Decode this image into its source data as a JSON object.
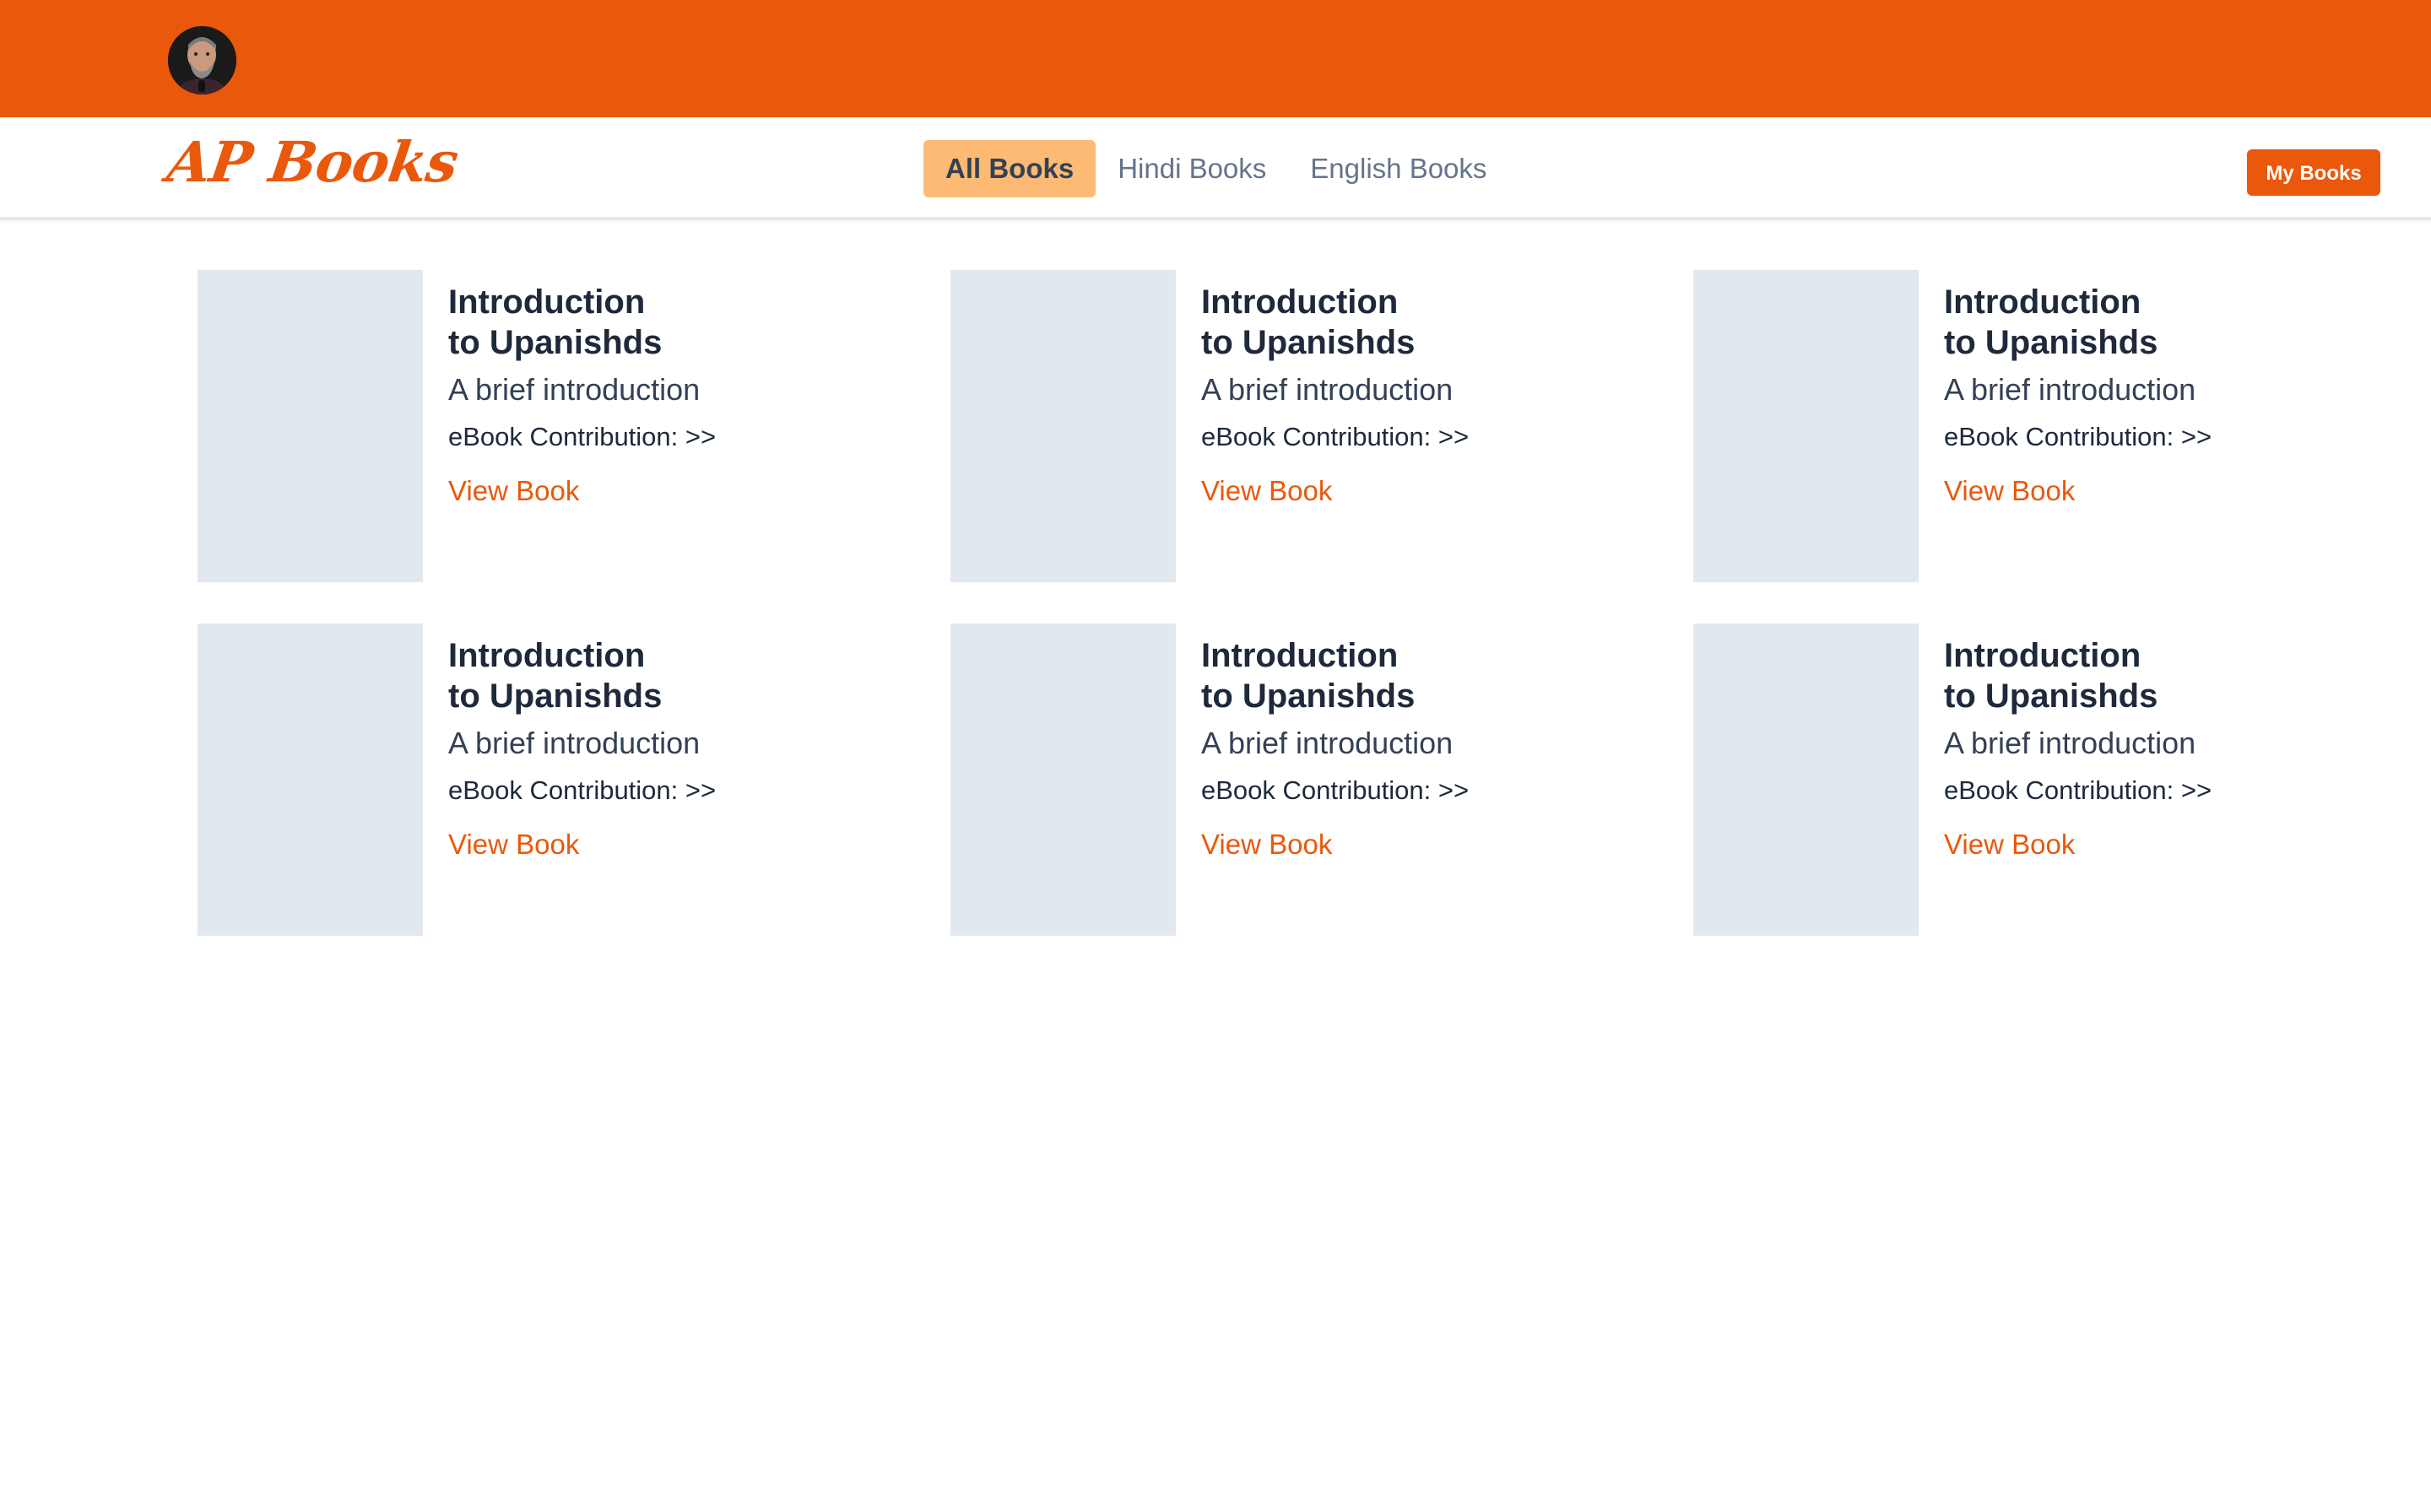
{
  "header": {
    "avatar_alt": "profile photo"
  },
  "nav": {
    "logo": "AP Books",
    "tabs": [
      {
        "label": "All Books",
        "active": true
      },
      {
        "label": "Hindi Books",
        "active": false
      },
      {
        "label": "English Books",
        "active": false
      }
    ],
    "my_books_label": "My Books"
  },
  "books": [
    {
      "title_line1": "Introduction",
      "title_line2": "to Upanishds",
      "subtitle": "A brief introduction",
      "contribution": "eBook Contribution: >>",
      "link": "View Book"
    },
    {
      "title_line1": "Introduction",
      "title_line2": "to Upanishds",
      "subtitle": "A brief introduction",
      "contribution": "eBook Contribution: >>",
      "link": "View Book"
    },
    {
      "title_line1": "Introduction",
      "title_line2": "to Upanishds",
      "subtitle": "A brief introduction",
      "contribution": "eBook Contribution: >>",
      "link": "View Book"
    },
    {
      "title_line1": "Introduction",
      "title_line2": "to Upanishds",
      "subtitle": "A brief introduction",
      "contribution": "eBook Contribution: >>",
      "link": "View Book"
    },
    {
      "title_line1": "Introduction",
      "title_line2": "to Upanishds",
      "subtitle": "A brief introduction",
      "contribution": "eBook Contribution: >>",
      "link": "View Book"
    },
    {
      "title_line1": "Introduction",
      "title_line2": "to Upanishds",
      "subtitle": "A brief introduction",
      "contribution": "eBook Contribution: >>",
      "link": "View Book"
    }
  ],
  "colors": {
    "brand": "#ea580c",
    "active_tab": "#fdba74",
    "cover_placeholder": "#e2e8f0"
  }
}
